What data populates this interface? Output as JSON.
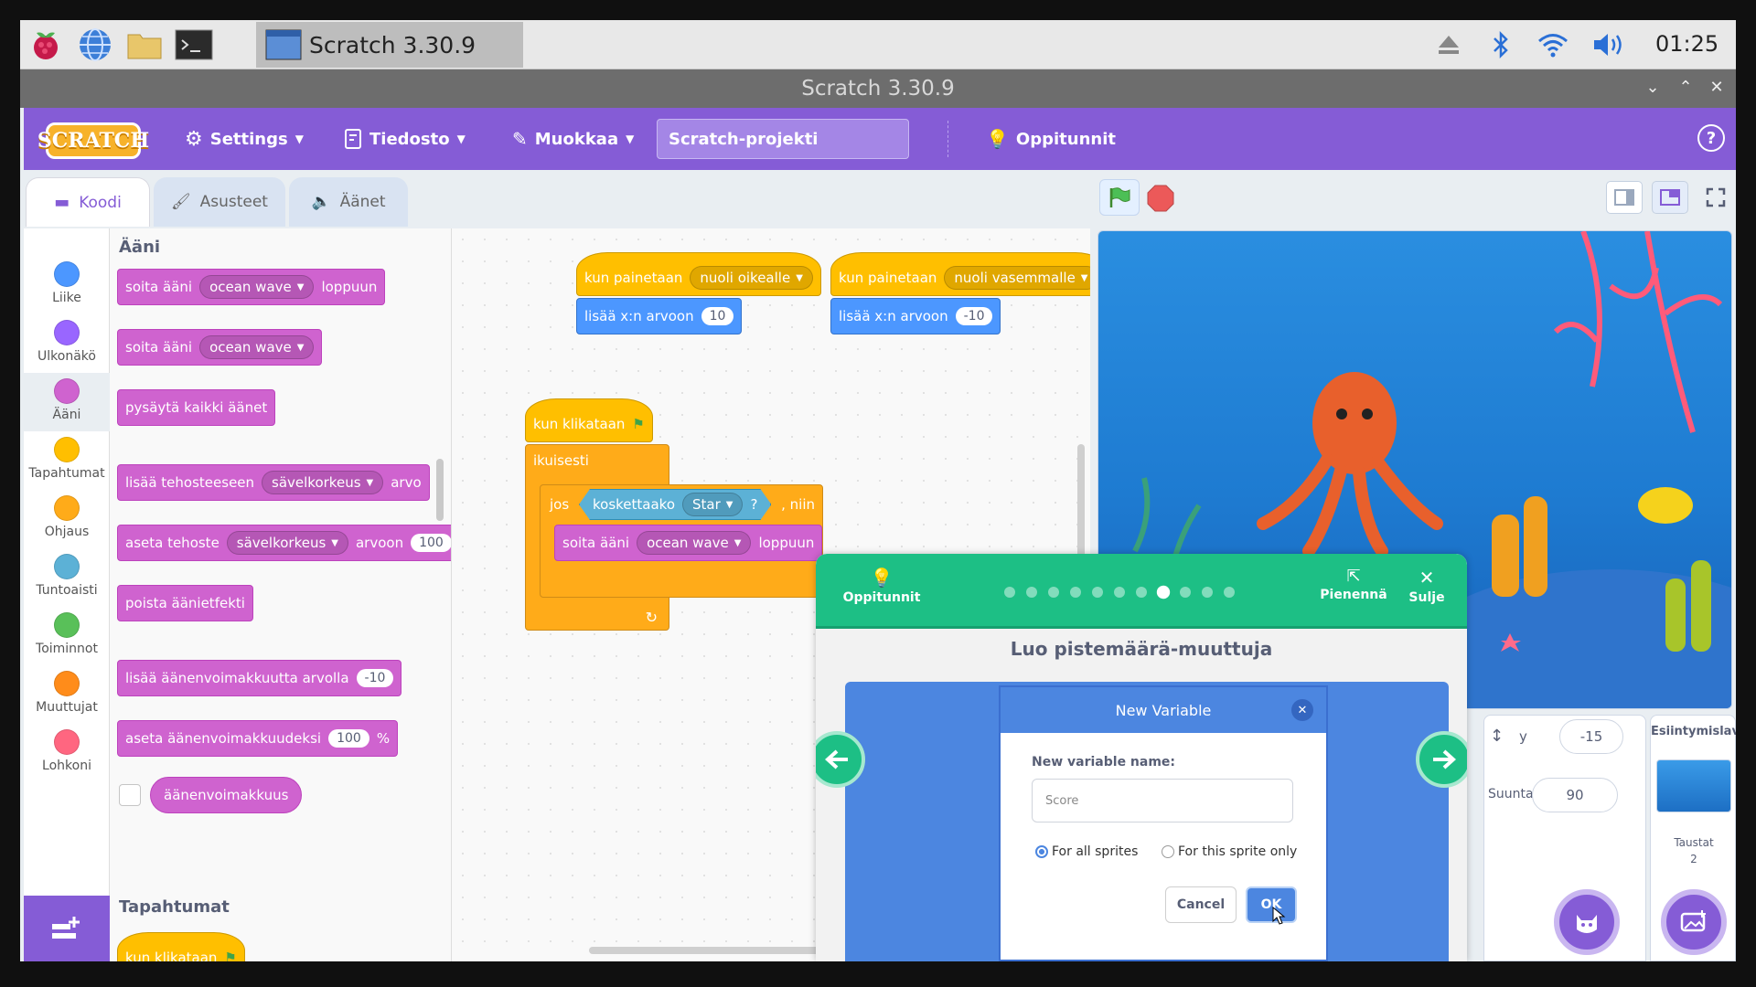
{
  "taskbar": {
    "task_title": "Scratch 3.30.9",
    "clock": "01:25",
    "icons": [
      "raspberry-menu-icon",
      "browser-icon",
      "folder-icon",
      "terminal-icon"
    ],
    "tray_icons": [
      "eject-icon",
      "bluetooth-icon",
      "wifi-icon",
      "volume-icon"
    ]
  },
  "window": {
    "title": "Scratch 3.30.9"
  },
  "menubar": {
    "logo": "SCRATCH",
    "settings": "Settings",
    "file": "Tiedosto",
    "edit": "Muokkaa",
    "project_name": "Scratch-projekti",
    "tutorials": "Oppitunnit",
    "help": "?"
  },
  "tabs": {
    "code": "Koodi",
    "costumes": "Asusteet",
    "sounds": "Äänet"
  },
  "categories": [
    {
      "label": "Liike",
      "color": "#4c97ff"
    },
    {
      "label": "Ulkonäkö",
      "color": "#9966ff"
    },
    {
      "label": "Ääni",
      "color": "#cf63cf"
    },
    {
      "label": "Tapahtumat",
      "color": "#ffbf00"
    },
    {
      "label": "Ohjaus",
      "color": "#ffab19"
    },
    {
      "label": "Tuntoaisti",
      "color": "#5cb1d6"
    },
    {
      "label": "Toiminnot",
      "color": "#59c059"
    },
    {
      "label": "Muuttujat",
      "color": "#ff8c1a"
    },
    {
      "label": "Lohkoni",
      "color": "#ff6680"
    }
  ],
  "palette": {
    "sound_title": "Ääni",
    "b1": {
      "pre": "soita ääni",
      "dd": "ocean wave",
      "post": "loppuun"
    },
    "b2": {
      "pre": "soita ääni",
      "dd": "ocean wave"
    },
    "b3": "pysäytä kaikki äänet",
    "b4": {
      "pre": "lisää tehosteeseen",
      "dd": "sävelkorkeus",
      "post": "arvo"
    },
    "b5": {
      "pre": "aseta tehoste",
      "dd": "sävelkorkeus",
      "post": "arvoon",
      "val": "100"
    },
    "b6": "poista äänietfekti",
    "b7": {
      "pre": "lisää äänenvoimakkuutta arvolla",
      "val": "-10"
    },
    "b8": {
      "pre": "aseta äänenvoimakkuudeksi",
      "val": "100",
      "post": "%"
    },
    "b9": "äänenvoimakkuus",
    "events_title": "Tapahtumat",
    "b10": "kun klikataan"
  },
  "script": {
    "s1_hat": "kun painetaan",
    "s1_dd": "nuoli oikealle",
    "s1_move": "lisää x:n arvoon",
    "s1_val": "10",
    "s2_hat": "kun painetaan",
    "s2_dd": "nuoli vasemmalle",
    "s2_move": "lisää x:n arvoon",
    "s2_val": "-10",
    "s3_hat": "kun klikataan",
    "forever": "ikuisesti",
    "if": "jos",
    "touching": "koskettaako",
    "touch_dd": "Star",
    "q": "?",
    "then": ", niin",
    "play": "soita ääni",
    "play_dd": "ocean wave",
    "play_post": "loppuun"
  },
  "sprite_info": {
    "y_label": "y",
    "y_value": "-15",
    "direction_label": "Suunta",
    "direction_value": "90"
  },
  "stage_pane": {
    "title": "Esiintymislava",
    "backdrops_label": "Taustat",
    "backdrops_count": "2"
  },
  "tutorial": {
    "tutorials_label": "Oppitunnit",
    "shrink_label": "Pienennä",
    "close_label": "Sulje",
    "title": "Luo pistemäärä-muuttuja",
    "progress": {
      "total": 11,
      "current": 8
    }
  },
  "dialog": {
    "title": "New Variable",
    "field_label": "New variable name:",
    "field_value": "Score",
    "option_all": "For all sprites",
    "option_this": "For this sprite only",
    "cancel": "Cancel",
    "ok": "OK"
  }
}
